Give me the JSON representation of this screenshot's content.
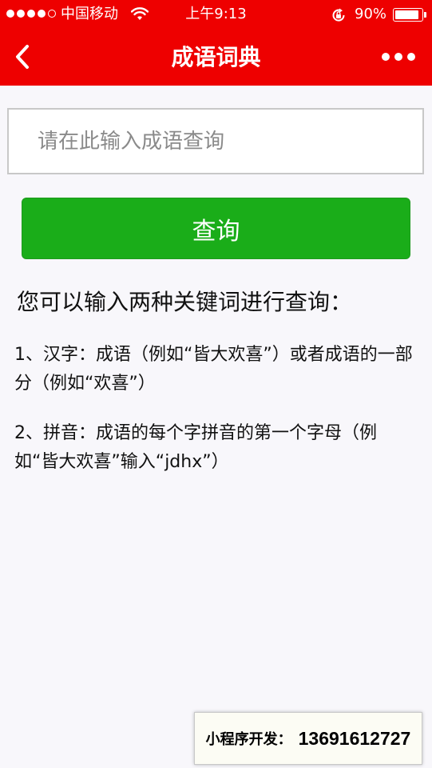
{
  "status_bar": {
    "carrier": "中国移动",
    "time": "上午9:13",
    "battery_percent": "90%",
    "battery_level": 0.9,
    "signal_bars_filled": 4,
    "signal_bars_total": 5,
    "icons": [
      "wifi-icon",
      "orientation-lock-icon",
      "battery-icon"
    ]
  },
  "nav": {
    "title": "成语词典",
    "back_icon": "chevron-left-icon",
    "more_icon": "more-dots-icon"
  },
  "search": {
    "placeholder": "请在此输入成语查询",
    "value": "",
    "button_label": "查询"
  },
  "help": {
    "heading": "您可以输入两种关键词进行查询：",
    "items": [
      "1、汉字：成语（例如“皆大欢喜”）或者成语的一部分（例如“欢喜”）",
      "2、拼音：成语的每个字拼音的第一个字母（例如“皆大欢喜”输入“jdhx”）"
    ]
  },
  "footer": {
    "label": "小程序开发：",
    "phone": "13691612727"
  },
  "colors": {
    "nav_bg": "#ee0000",
    "button_bg": "#1aad19",
    "page_bg": "#f8f7fb",
    "banner_bg": "#fcfcf4"
  }
}
